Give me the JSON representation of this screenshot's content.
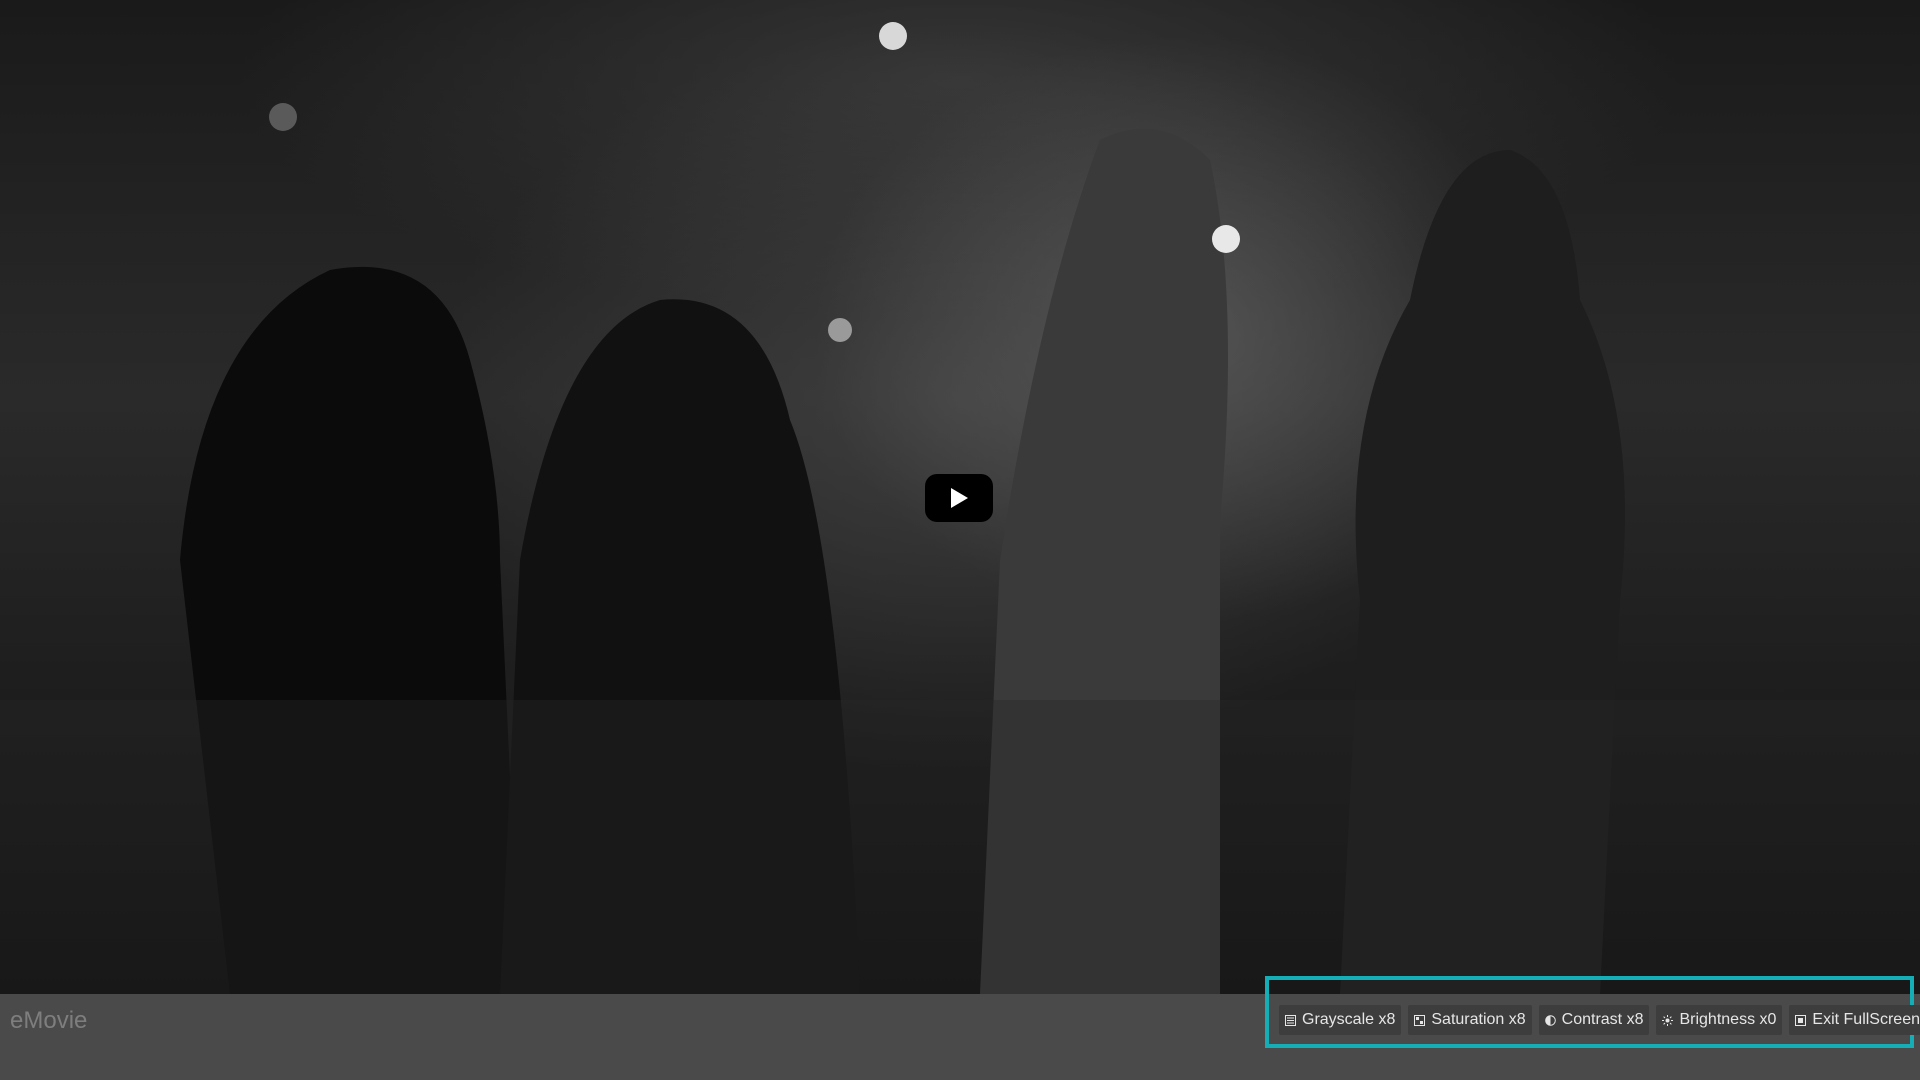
{
  "app": {
    "brand": "eMovie"
  },
  "player": {
    "play_icon": "play-icon",
    "controls": [
      {
        "id": "grayscale",
        "label": "Grayscale x8",
        "icon": "grayscale-icon"
      },
      {
        "id": "saturation",
        "label": "Saturation x8",
        "icon": "saturation-icon"
      },
      {
        "id": "contrast",
        "label": "Contrast x8",
        "icon": "contrast-icon"
      },
      {
        "id": "brightness",
        "label": "Brightness x0",
        "icon": "brightness-icon"
      },
      {
        "id": "fullscreen",
        "label": "Exit FullScreen",
        "icon": "exit-fullscreen-icon"
      }
    ]
  },
  "colors": {
    "highlight": "#16aeb6",
    "controlbar": "#4a4a4a",
    "button_bg": "#3d3d3d",
    "button_text": "#e6e6e6"
  }
}
